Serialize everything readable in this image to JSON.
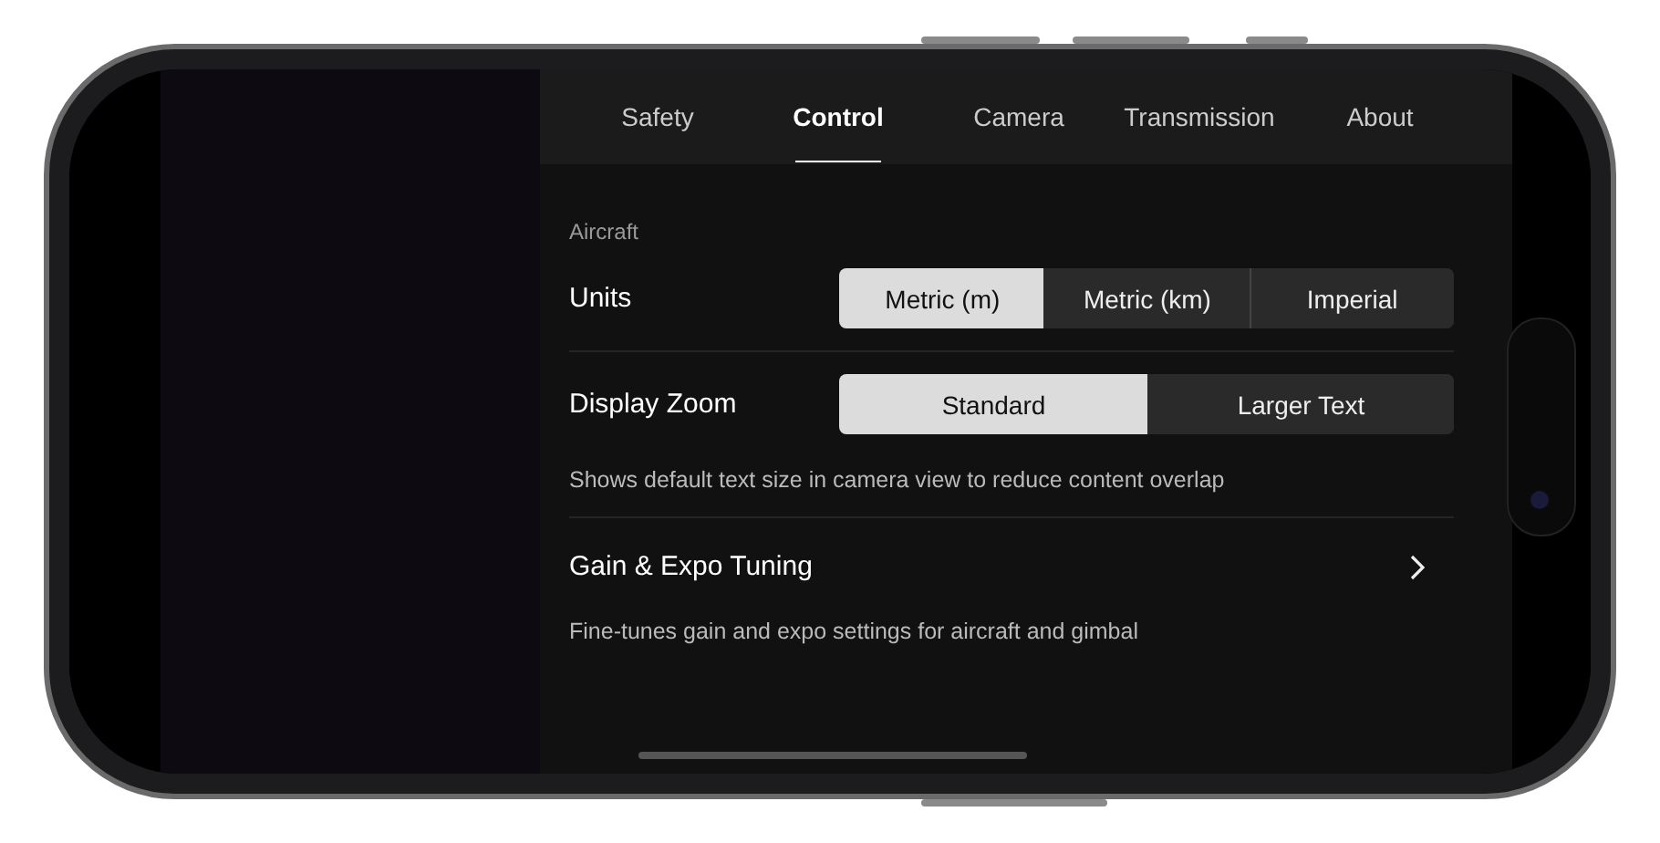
{
  "tabs": [
    {
      "label": "Safety",
      "selected": false
    },
    {
      "label": "Control",
      "selected": true
    },
    {
      "label": "Camera",
      "selected": false
    },
    {
      "label": "Transmission",
      "selected": false
    },
    {
      "label": "About",
      "selected": false
    }
  ],
  "section": "Aircraft",
  "settings": [
    {
      "kind": "segmented",
      "label": "Units",
      "options": [
        {
          "label": "Metric (m)",
          "selected": true
        },
        {
          "label": "Metric (km)",
          "selected": false
        },
        {
          "label": "Imperial",
          "selected": false
        }
      ]
    },
    {
      "kind": "segmented",
      "label": "Display Zoom",
      "options": [
        {
          "label": "Standard",
          "selected": true
        },
        {
          "label": "Larger Text",
          "selected": false
        }
      ],
      "description": "Shows default text size in camera view to reduce content overlap"
    },
    {
      "kind": "link",
      "label": "Gain & Expo Tuning",
      "description": "Fine-tunes gain and expo settings for aircraft and gimbal"
    }
  ]
}
